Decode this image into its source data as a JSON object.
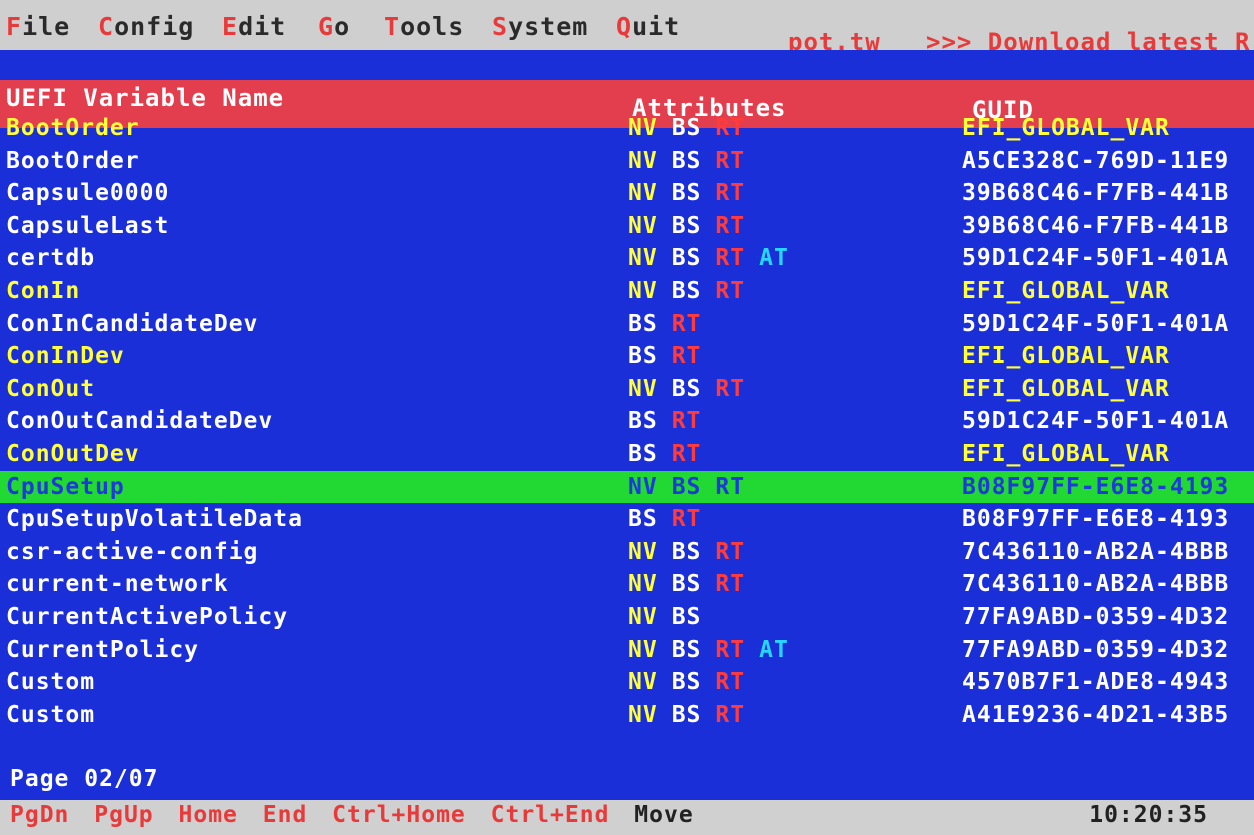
{
  "menu": [
    {
      "hot": "F",
      "rest": "ile"
    },
    {
      "hot": "C",
      "rest": "onfig"
    },
    {
      "hot": "E",
      "rest": "dit"
    },
    {
      "hot": "G",
      "rest": "o"
    },
    {
      "hot": "T",
      "rest": "ools"
    },
    {
      "hot": "S",
      "rest": "ystem"
    },
    {
      "hot": "Q",
      "rest": "uit"
    }
  ],
  "site": "pot.tw",
  "download": ">>> Download latest R",
  "headers": {
    "name": "UEFI Variable Name",
    "attributes": "Attributes",
    "guid": "GUID"
  },
  "rows": [
    {
      "name": "BootOrder",
      "highlight": true,
      "attrs": [
        "NV",
        "BS",
        "RT"
      ],
      "guid": "EFI_GLOBAL_VAR"
    },
    {
      "name": "BootOrder",
      "highlight": false,
      "attrs": [
        "NV",
        "BS",
        "RT"
      ],
      "guid": "A5CE328C-769D-11E9"
    },
    {
      "name": "Capsule0000",
      "highlight": false,
      "attrs": [
        "NV",
        "BS",
        "RT"
      ],
      "guid": "39B68C46-F7FB-441B"
    },
    {
      "name": "CapsuleLast",
      "highlight": false,
      "attrs": [
        "NV",
        "BS",
        "RT"
      ],
      "guid": "39B68C46-F7FB-441B"
    },
    {
      "name": "certdb",
      "highlight": false,
      "attrs": [
        "NV",
        "BS",
        "RT",
        "AT"
      ],
      "guid": "59D1C24F-50F1-401A"
    },
    {
      "name": "ConIn",
      "highlight": true,
      "attrs": [
        "NV",
        "BS",
        "RT"
      ],
      "guid": "EFI_GLOBAL_VAR"
    },
    {
      "name": "ConInCandidateDev",
      "highlight": false,
      "attrs": [
        "BS",
        "RT"
      ],
      "guid": "59D1C24F-50F1-401A"
    },
    {
      "name": "ConInDev",
      "highlight": true,
      "attrs": [
        "BS",
        "RT"
      ],
      "guid": "EFI_GLOBAL_VAR"
    },
    {
      "name": "ConOut",
      "highlight": true,
      "attrs": [
        "NV",
        "BS",
        "RT"
      ],
      "guid": "EFI_GLOBAL_VAR"
    },
    {
      "name": "ConOutCandidateDev",
      "highlight": false,
      "attrs": [
        "BS",
        "RT"
      ],
      "guid": "59D1C24F-50F1-401A"
    },
    {
      "name": "ConOutDev",
      "highlight": true,
      "attrs": [
        "BS",
        "RT"
      ],
      "guid": "EFI_GLOBAL_VAR"
    },
    {
      "name": "CpuSetup",
      "highlight": false,
      "selected": true,
      "attrs": [
        "NV",
        "BS",
        "RT"
      ],
      "guid": "B08F97FF-E6E8-4193"
    },
    {
      "name": "CpuSetupVolatileData",
      "highlight": false,
      "attrs": [
        "BS",
        "RT"
      ],
      "guid": "B08F97FF-E6E8-4193"
    },
    {
      "name": "csr-active-config",
      "highlight": false,
      "attrs": [
        "NV",
        "BS",
        "RT"
      ],
      "guid": "7C436110-AB2A-4BBB"
    },
    {
      "name": "current-network",
      "highlight": false,
      "attrs": [
        "NV",
        "BS",
        "RT"
      ],
      "guid": "7C436110-AB2A-4BBB"
    },
    {
      "name": "CurrentActivePolicy",
      "highlight": false,
      "attrs": [
        "NV",
        "BS"
      ],
      "guid": "77FA9ABD-0359-4D32"
    },
    {
      "name": "CurrentPolicy",
      "highlight": false,
      "attrs": [
        "NV",
        "BS",
        "RT",
        "AT"
      ],
      "guid": "77FA9ABD-0359-4D32"
    },
    {
      "name": "Custom",
      "highlight": false,
      "attrs": [
        "NV",
        "BS",
        "RT"
      ],
      "guid": "4570B7F1-ADE8-4943"
    },
    {
      "name": "Custom",
      "highlight": false,
      "attrs": [
        "NV",
        "BS",
        "RT"
      ],
      "guid": "A41E9236-4D21-43B5"
    }
  ],
  "page": "Page 02/07",
  "keys": [
    "PgDn",
    "PgUp",
    "Home",
    "End",
    "Ctrl+Home",
    "Ctrl+End"
  ],
  "move": "Move",
  "clock": "10:20:35"
}
